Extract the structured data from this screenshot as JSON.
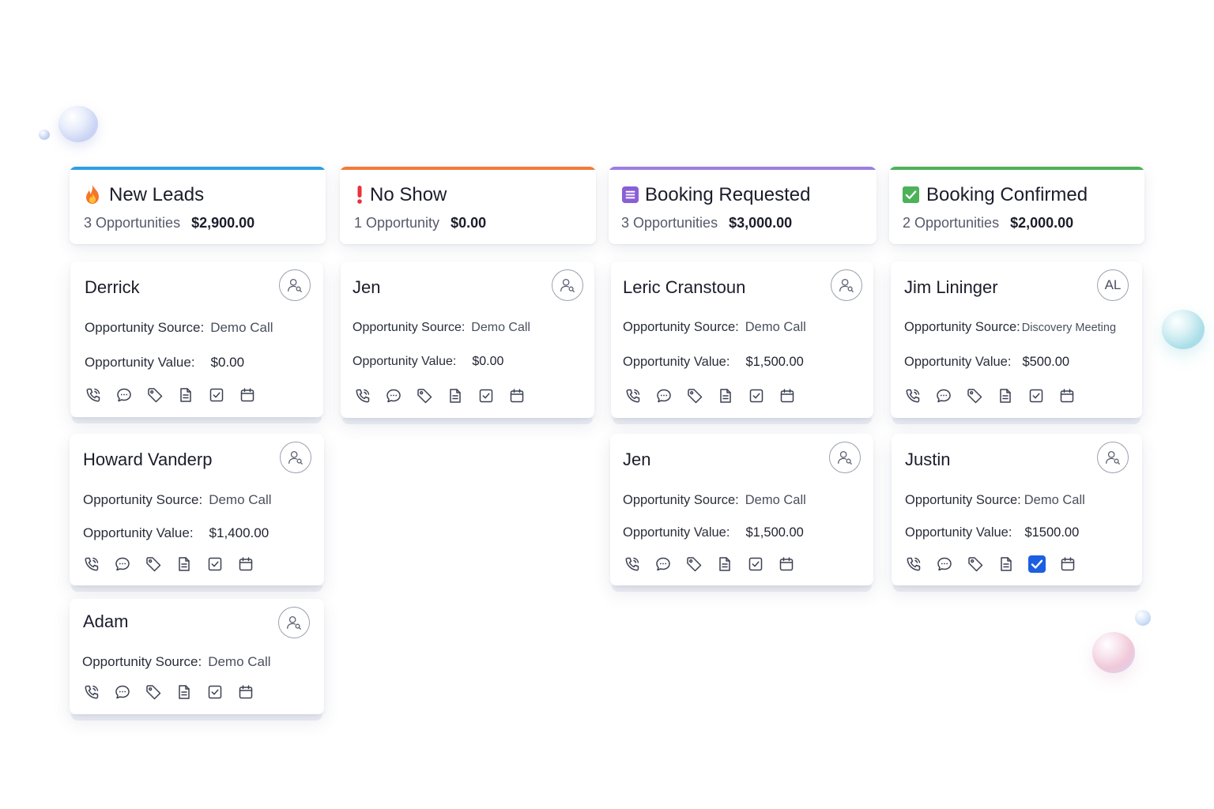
{
  "columns": [
    {
      "title": "New Leads",
      "icon": "fire-icon",
      "accent": "#2b9fe3",
      "count_label": "3 Opportunities",
      "total": "$2,900.00",
      "cards": [
        {
          "name": "Derrick",
          "source_label": "Opportunity Source:",
          "source": "Demo Call",
          "value_label": "Opportunity Value:",
          "value": "$0.00"
        },
        {
          "name": "Howard Vanderp",
          "source_label": "Opportunity Source:",
          "source": "Demo Call",
          "value_label": "Opportunity Value:",
          "value": "$1,400.00"
        },
        {
          "name": "Adam",
          "source_label": "Opportunity Source:",
          "source": "Demo Call"
        }
      ]
    },
    {
      "title": "No Show",
      "icon": "exclamation-icon",
      "accent": "#f27a37",
      "count_label": "1 Opportunity",
      "total": "$0.00",
      "cards": [
        {
          "name": "Jen",
          "source_label": "Opportunity Source:",
          "source": "Demo Call",
          "value_label": "Opportunity Value:",
          "value": "$0.00"
        }
      ]
    },
    {
      "title": "Booking Requested",
      "icon": "list-icon",
      "accent": "#9b7ee0",
      "count_label": "3 Opportunities",
      "total": "$3,000.00",
      "cards": [
        {
          "name": "Leric Cranstoun",
          "source_label": "Opportunity Source:",
          "source": "Demo Call",
          "value_label": "Opportunity Value:",
          "value": "$1,500.00"
        },
        {
          "name": "Jen",
          "source_label": "Opportunity Source:",
          "source": "Demo Call",
          "value_label": "Opportunity Value:",
          "value": "$1,500.00"
        }
      ]
    },
    {
      "title": "Booking Confirmed",
      "icon": "checkbox-icon",
      "accent": "#4cb258",
      "count_label": "2 Opportunities",
      "total": "$2,000.00",
      "cards": [
        {
          "name": "Jim Lininger",
          "avatar_initials": "AL",
          "source_label": "Opportunity Source:",
          "source": "Discovery Meeting",
          "value_label": "Opportunity Value:",
          "value": "$500.00"
        },
        {
          "name": "Justin",
          "source_label": "Opportunity Source:",
          "source": "Demo Call",
          "value_label": "Opportunity Value:",
          "value": "$1500.00",
          "task_checked": true
        }
      ]
    }
  ],
  "card_action_icons": [
    "phone-icon",
    "chat-icon",
    "tag-icon",
    "document-icon",
    "task-checkbox-icon",
    "calendar-icon"
  ]
}
